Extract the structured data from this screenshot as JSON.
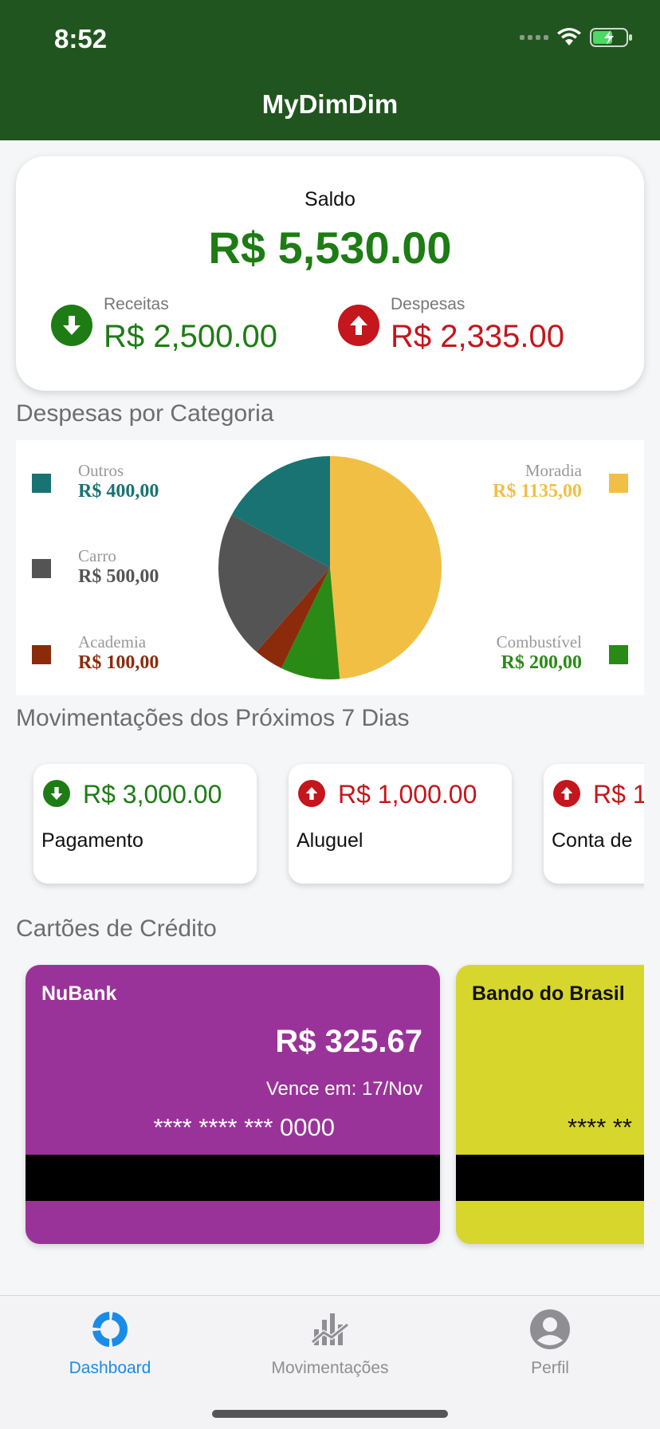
{
  "status_bar": {
    "time": "8:52"
  },
  "app": {
    "title": "MyDimDim"
  },
  "balance": {
    "label": "Saldo",
    "value": "R$ 5,530.00",
    "income": {
      "label": "Receitas",
      "value": "R$ 2,500.00"
    },
    "expenses": {
      "label": "Despesas",
      "value": "R$ 2,335.00"
    }
  },
  "colors": {
    "header": "#21551f",
    "income": "#1e7c14",
    "expense": "#c4161c",
    "nav_active": "#1a8ce8",
    "nav_inactive": "#8e8e93"
  },
  "sections": {
    "categories": "Despesas por Categoria",
    "upcoming": "Movimentações dos Próximos 7 Dias",
    "credit_cards": "Cartões de Crédito"
  },
  "chart_data": {
    "type": "pie",
    "slices": [
      {
        "label": "Moradia",
        "value": 1135,
        "display": "R$ 1135,00",
        "color": "#f2bf45"
      },
      {
        "label": "Combustível",
        "value": 200,
        "display": "R$ 200,00",
        "color": "#2a8a16"
      },
      {
        "label": "Academia",
        "value": 100,
        "display": "R$ 100,00",
        "color": "#8c2b0b"
      },
      {
        "label": "Carro",
        "value": 500,
        "display": "R$ 500,00",
        "color": "#545454"
      },
      {
        "label": "Outros",
        "value": 400,
        "display": "R$ 400,00",
        "color": "#197372"
      }
    ]
  },
  "upcoming": [
    {
      "type": "income",
      "amount": "R$ 3,000.00",
      "description": "Pagamento"
    },
    {
      "type": "expense",
      "amount": "R$ 1,000.00",
      "description": "Aluguel"
    },
    {
      "type": "expense",
      "amount": "R$ 1",
      "description": "Conta de"
    }
  ],
  "credit_cards": [
    {
      "name": "NuBank",
      "value": "R$ 325.67",
      "due": "Vence em: 17/Nov",
      "number": "**** **** *** 0000",
      "color": "#9a3399",
      "text_color": "#ffffff"
    },
    {
      "name": "Bando do Brasil",
      "value": "",
      "due": "",
      "number": "**** **",
      "color": "#d7d62c",
      "text_color": "#111111"
    }
  ],
  "bottom_nav": [
    {
      "label": "Dashboard",
      "icon": "dashboard-icon",
      "active": true
    },
    {
      "label": "Movimentações",
      "icon": "chart-trend-icon",
      "active": false
    },
    {
      "label": "Perfil",
      "icon": "profile-icon",
      "active": false
    }
  ]
}
